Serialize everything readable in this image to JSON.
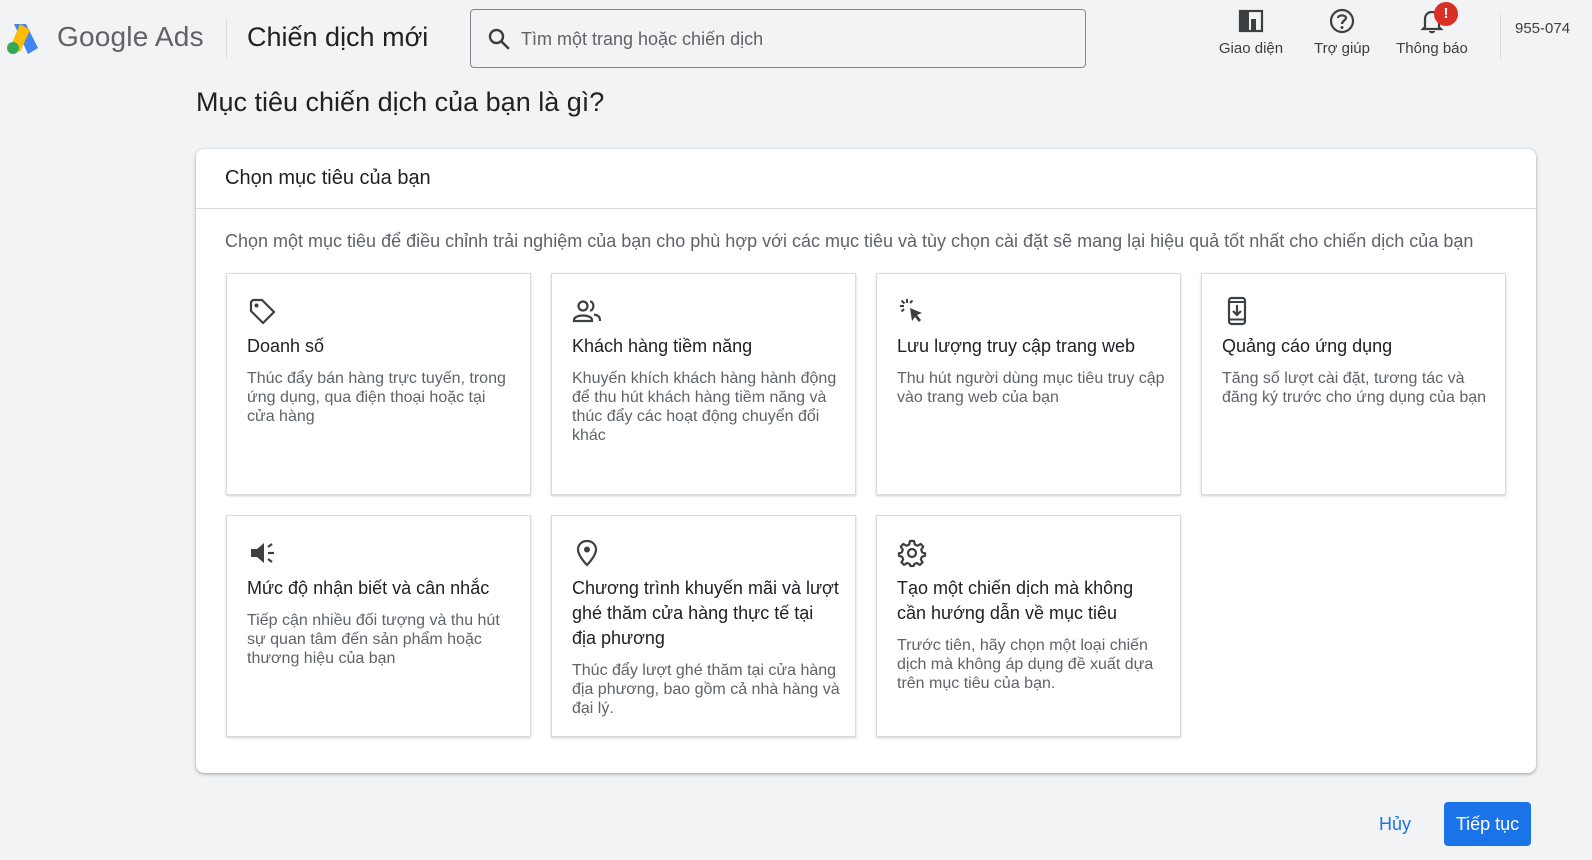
{
  "header": {
    "product_name": "Google Ads",
    "page_title": "Chiến dịch mới",
    "search_placeholder": "Tìm một trang hoặc chiến dịch",
    "actions": [
      {
        "label": "Giao diện",
        "icon": "appearance-icon"
      },
      {
        "label": "Trợ giúp",
        "icon": "help-icon"
      },
      {
        "label": "Thông báo",
        "icon": "bell-icon",
        "badge": "!"
      }
    ],
    "account_id": "955-074"
  },
  "main": {
    "question": "Mục tiêu chiến dịch của bạn là gì?",
    "card_title": "Chọn mục tiêu của bạn",
    "card_description": "Chọn một mục tiêu để điều chỉnh trải nghiệm của bạn cho phù hợp với các mục tiêu và tùy chọn cài đặt sẽ mang lại hiệu quả tốt nhất cho chiến dịch của bạn",
    "goals": [
      {
        "title": "Doanh số",
        "description": "Thúc đẩy bán hàng trực tuyến, trong ứng dụng, qua điện thoại hoặc tại cửa hàng",
        "icon": "tag-icon"
      },
      {
        "title": "Khách hàng tiềm năng",
        "description": "Khuyến khích khách hàng hành động để thu hút khách hàng tiềm năng và thúc đẩy các hoạt động chuyển đổi khác",
        "icon": "people-icon"
      },
      {
        "title": "Lưu lượng truy cập trang web",
        "description": "Thu hút người dùng mục tiêu truy cập vào trang web của bạn",
        "icon": "cursor-click-icon"
      },
      {
        "title": "Quảng cáo ứng dụng",
        "description": "Tăng số lượt cài đặt, tương tác và đăng ký trước cho ứng dụng của bạn",
        "icon": "phone-download-icon"
      },
      {
        "title": "Mức độ nhận biết và cân nhắc",
        "description": "Tiếp cận nhiều đối tượng và thu hút sự quan tâm đến sản phẩm hoặc thương hiệu của bạn",
        "icon": "megaphone-icon"
      },
      {
        "title": "Chương trình khuyến mãi và lượt ghé thăm cửa hàng thực tế tại địa phương",
        "description": "Thúc đẩy lượt ghé thăm tại cửa hàng địa phương, bao gồm cả nhà hàng và đại lý.",
        "icon": "location-pin-icon"
      },
      {
        "title": "Tạo một chiến dịch mà không cần hướng dẫn về mục tiêu",
        "description": "Trước tiên, hãy chọn một loại chiến dịch mà không áp dụng đề xuất dựa trên mục tiêu của bạn.",
        "icon": "gear-icon"
      }
    ]
  },
  "footer": {
    "cancel_label": "Hủy",
    "continue_label": "Tiếp tục"
  },
  "colors": {
    "primary": "#1a73e8",
    "badge": "#d93025",
    "background": "#f1f3f4"
  }
}
